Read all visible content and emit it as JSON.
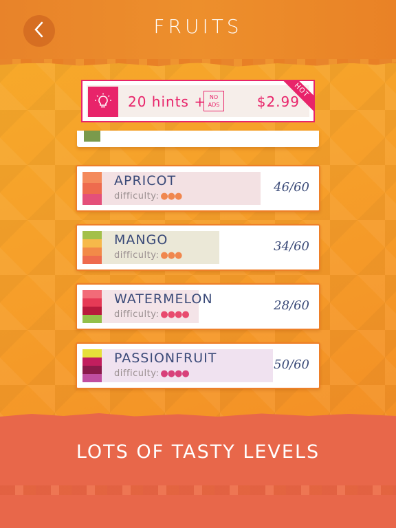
{
  "header": {
    "title": "FRUITS",
    "back_icon": "chevron-left-icon"
  },
  "promo": {
    "icon": "lightbulb-icon",
    "hints_text": "20 hints +",
    "noads_line1": "NO",
    "noads_line2": "ADS",
    "price": "$2.99",
    "badge": "HOT",
    "accent": "#e8246a"
  },
  "levels": [
    {
      "name": "APRICOT",
      "difficulty_label": "difficulty:",
      "difficulty_dots": 3,
      "score": "46/60",
      "progress": 0.77,
      "colors": [
        "#f48a5c",
        "#ee6b4e",
        "#e4507a"
      ],
      "bar_color": "#f3e1e3",
      "dot_color": "#f0874e"
    },
    {
      "name": "MANGO",
      "difficulty_label": "difficulty:",
      "difficulty_dots": 3,
      "score": "34/60",
      "progress": 0.57,
      "colors": [
        "#a3c04a",
        "#f6b94a",
        "#f28a48",
        "#ee6b4e"
      ],
      "bar_color": "#ebe8d7",
      "dot_color": "#f0874e"
    },
    {
      "name": "WATERMELON",
      "difficulty_label": "difficulty:",
      "difficulty_dots": 4,
      "score": "28/60",
      "progress": 0.47,
      "colors": [
        "#f26b78",
        "#e63a56",
        "#b81a3c",
        "#94c04a"
      ],
      "bar_color": "#f4e4e8",
      "dot_color": "#e84a6e"
    },
    {
      "name": "PASSIONFRUIT",
      "difficulty_label": "difficulty:",
      "difficulty_dots": 4,
      "score": "50/60",
      "progress": 0.83,
      "colors": [
        "#e6e03a",
        "#c21e5e",
        "#8a1a4a",
        "#c04ea0"
      ],
      "bar_color": "#f0e2f0",
      "dot_color": "#d8407a"
    }
  ],
  "footer": {
    "text": "LOTS OF TASTY LEVELS"
  }
}
